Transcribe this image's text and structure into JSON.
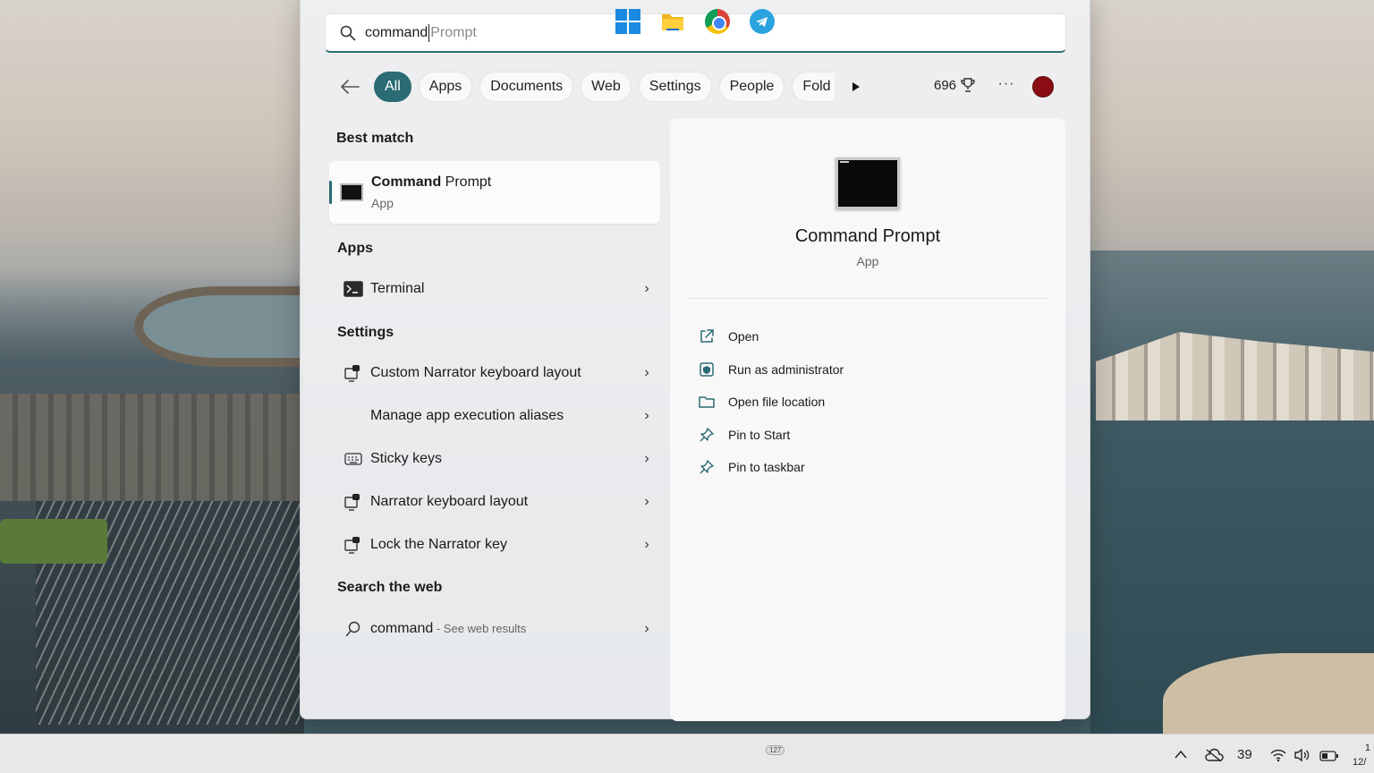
{
  "search": {
    "typed": "command",
    "suggestion": "Prompt"
  },
  "filters": {
    "tabs": [
      "All",
      "Apps",
      "Documents",
      "Web",
      "Settings",
      "People",
      "Fold"
    ],
    "active": "All",
    "points": "696"
  },
  "best_match": {
    "section": "Best match",
    "name_bold": "Command",
    "name_rest": " Prompt",
    "type": "App"
  },
  "apps": {
    "section": "Apps",
    "items": [
      {
        "label": "Terminal",
        "icon": "terminal-icon"
      }
    ]
  },
  "settings": {
    "section": "Settings",
    "items": [
      {
        "label": "Custom Narrator keyboard layout",
        "icon": "narrator-icon"
      },
      {
        "label": "Manage app execution aliases",
        "icon": ""
      },
      {
        "label": "Sticky keys",
        "icon": "keyboard-icon"
      },
      {
        "label": "Narrator keyboard layout",
        "icon": "narrator-icon"
      },
      {
        "label": "Lock the Narrator key",
        "icon": "narrator-icon"
      }
    ]
  },
  "web": {
    "section": "Search the web",
    "query": "command",
    "suffix": " - See web results"
  },
  "preview": {
    "title": "Command Prompt",
    "subtitle": "App",
    "actions": [
      {
        "label": "Open",
        "icon": "open-external-icon"
      },
      {
        "label": "Run as administrator",
        "icon": "shield-icon"
      },
      {
        "label": "Open file location",
        "icon": "folder-icon"
      },
      {
        "label": "Pin to Start",
        "icon": "pin-icon"
      },
      {
        "label": "Pin to taskbar",
        "icon": "pin-icon"
      }
    ]
  },
  "taskbar": {
    "telegram_badge": "127",
    "tray_temp": "39",
    "clock_partial": "12/",
    "clock_top": "1"
  },
  "colors": {
    "accent": "#2b6b73",
    "avatar": "#8a0d16"
  }
}
